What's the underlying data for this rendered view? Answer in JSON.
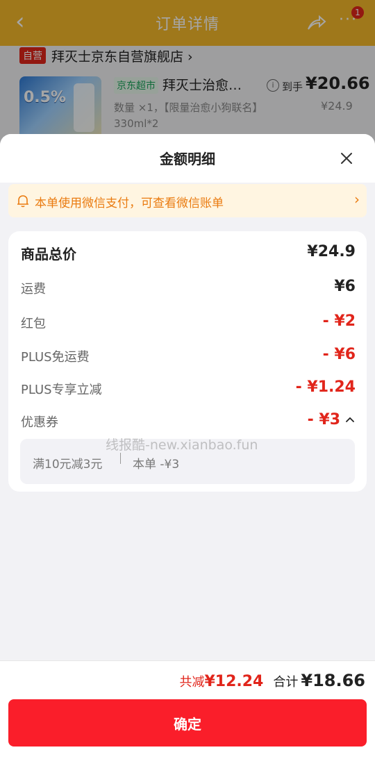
{
  "background": {
    "title": "订单详情",
    "badge_count": "1",
    "store_tag": "自营",
    "store_name": "拜灭士京东自营旗舰店 ›",
    "product": {
      "image_text": "0.5%",
      "channel_tag": "京东超市",
      "title": "拜灭士治愈…",
      "spec": "数量 ×1，【限量治愈小狗联名】330ml*2",
      "price_label": "到手",
      "price": "¥20.66",
      "original_price": "¥24.9"
    }
  },
  "sheet": {
    "title": "金额明细",
    "notice": "本单使用微信支付，可查看微信账单",
    "rows": [
      {
        "label": "商品总价",
        "value": "¥24.9"
      },
      {
        "label": "运费",
        "value": "¥6"
      },
      {
        "label": "红包",
        "value": "- ¥2"
      },
      {
        "label": "PLUS免运费",
        "value": "- ¥6"
      },
      {
        "label": "PLUS专享立减",
        "value": "- ¥1.24"
      },
      {
        "label": "优惠券",
        "value": "- ¥3"
      }
    ],
    "coupon_detail": {
      "condition": "满10元减3元",
      "applied": "本单 -¥3"
    },
    "watermark": "线报酷-new.xianbao.fun"
  },
  "footer": {
    "discount_label": "共减",
    "discount_value": "¥12.24",
    "total_label": "合计",
    "total_value": "¥18.66",
    "confirm_label": "确定"
  },
  "colors": {
    "brand_yellow": "#f5b82a",
    "accent_red": "#e1251b",
    "confirm_red": "#fa1e2a",
    "notice_orange": "#ea7b10"
  }
}
